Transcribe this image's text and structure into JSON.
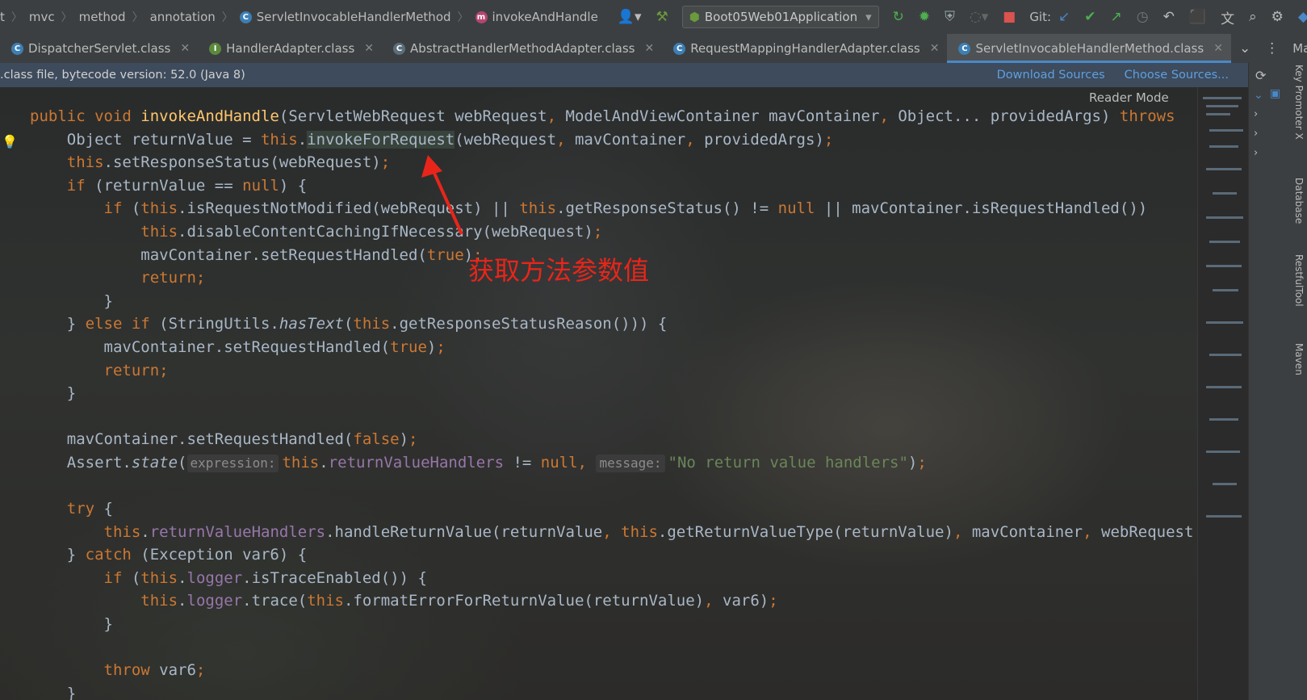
{
  "breadcrumb": {
    "items": [
      "t",
      "mvc",
      "method",
      "annotation",
      "ServletInvocableHandlerMethod",
      "invokeAndHandle"
    ]
  },
  "toolbar": {
    "run_config": "Boot05Web01Application",
    "git_label": "Git:"
  },
  "tabs": [
    {
      "label": "DispatcherServlet.class",
      "icon": "class-icon"
    },
    {
      "label": "HandlerAdapter.class",
      "icon": "interface-icon"
    },
    {
      "label": "AbstractHandlerMethodAdapter.class",
      "icon": "abstract-class-icon"
    },
    {
      "label": "RequestMappingHandlerAdapter.class",
      "icon": "class-icon"
    },
    {
      "label": "ServletInvocableHandlerMethod.class",
      "icon": "class-icon",
      "active": true
    }
  ],
  "maven_label": "Maven",
  "infobar": {
    "text": ".class file, bytecode version: 52.0 (Java 8)",
    "download_sources": "Download Sources",
    "choose_sources": "Choose Sources..."
  },
  "reader_mode": "Reader Mode",
  "annotation_text": "获取方法参数值",
  "side_labels": [
    "Key Promoter X",
    "Database",
    "RestfulTool",
    "Maven"
  ],
  "hints": {
    "expression": "expression:",
    "message": "message:"
  },
  "code_string": "\"No return value handlers\"",
  "colors": {
    "keyword": "#cc7832",
    "function": "#ffc66d",
    "field": "#9876aa",
    "string": "#6a8759",
    "annotation": "#e8251a",
    "link": "#5f9fe0"
  }
}
